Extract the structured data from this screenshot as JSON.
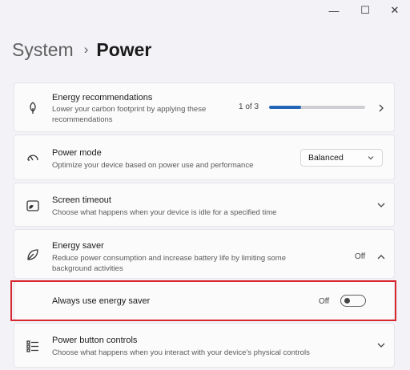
{
  "window": {
    "minimize_glyph": "—",
    "maximize_glyph": "☐",
    "close_glyph": "✕"
  },
  "breadcrumb": {
    "parent": "System",
    "separator": "›",
    "current": "Power"
  },
  "energy_recommendations": {
    "title": "Energy recommendations",
    "description": "Lower your carbon footprint by applying these recommendations",
    "progress_text": "1 of 3",
    "progress_fraction": 0.33,
    "icon": "leaf-icon"
  },
  "power_mode": {
    "title": "Power mode",
    "description": "Optimize your device based on power use and performance",
    "selected": "Balanced",
    "icon": "gauge-icon"
  },
  "screen_timeout": {
    "title": "Screen timeout",
    "description": "Choose what happens when your device is idle for a specified time",
    "icon": "screen-moon-icon"
  },
  "energy_saver": {
    "title": "Energy saver",
    "description": "Reduce power consumption and increase battery life by limiting some background activities",
    "state": "Off",
    "icon": "energy-saver-leaf-icon"
  },
  "always_use_energy_saver": {
    "label": "Always use energy saver",
    "state": "Off",
    "on": false
  },
  "power_button_controls": {
    "title": "Power button controls",
    "description": "Choose what happens when you interact with your device's physical controls",
    "icon": "list-controls-icon"
  },
  "colors": {
    "accent": "#2166b6",
    "highlight_border": "#d8282f"
  }
}
